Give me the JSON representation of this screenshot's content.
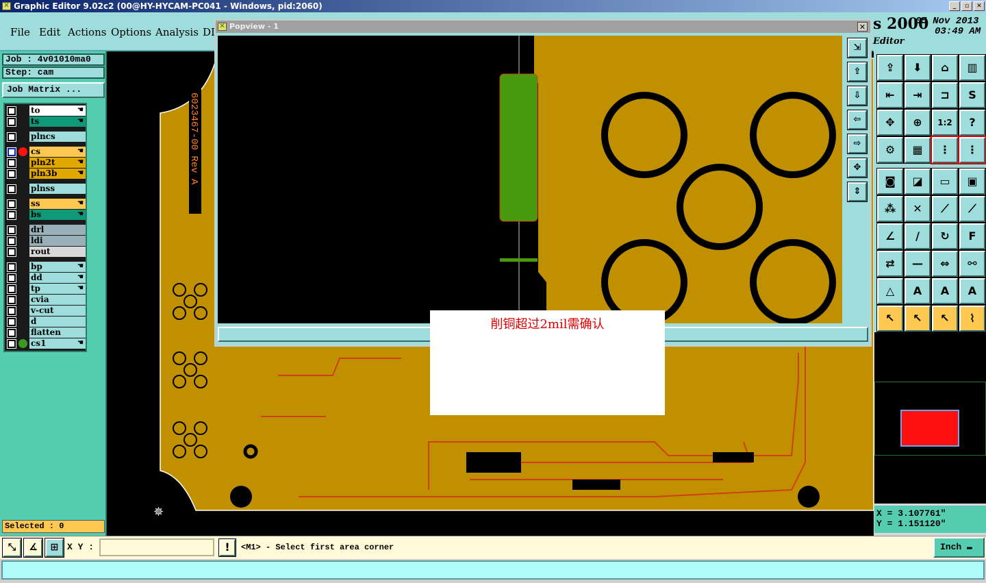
{
  "window": {
    "title": "Graphic Editor 9.02c2 (00@HY-HYCAM-PC041 - Windows, pid:2060)",
    "controls": [
      "_",
      "▫",
      "✕"
    ]
  },
  "menu": [
    "File",
    "Edit",
    "Actions",
    "Options",
    "Analysis",
    "DI"
  ],
  "header_right": {
    "product": "s 2000",
    "date": "05 Nov 2013",
    "time": "03:49 AM",
    "subtitle": "Editor"
  },
  "job": {
    "job_label": "Job : 4v01010ma0",
    "step_label": "Step: cam",
    "matrix_button": "Job Matrix ..."
  },
  "layers": [
    {
      "name": "to",
      "bg": "#ffffff",
      "hand": true
    },
    {
      "name": "ts",
      "bg": "#0e9a78",
      "hand": true
    },
    {
      "name": "plncs",
      "bg": "#9fdcdc",
      "hand": false
    },
    {
      "name": "cs",
      "bg": "#ffc850",
      "hand": true,
      "dot": "#ff1010",
      "active": true
    },
    {
      "name": "pln2t",
      "bg": "#e0a800",
      "hand": true
    },
    {
      "name": "pln3b",
      "bg": "#e0a800",
      "hand": true
    },
    {
      "name": "plnss",
      "bg": "#9fdcdc",
      "hand": false
    },
    {
      "name": "ss",
      "bg": "#ffc850",
      "hand": true
    },
    {
      "name": "bs",
      "bg": "#0e9a78",
      "hand": true
    },
    {
      "name": "drl",
      "bg": "#9ab0b8",
      "hand": false
    },
    {
      "name": "ldi",
      "bg": "#9ab0b8",
      "hand": false
    },
    {
      "name": "rout",
      "bg": "#d8d8d8",
      "hand": false
    },
    {
      "name": "bp",
      "bg": "#9fdcdc",
      "hand": true
    },
    {
      "name": "dd",
      "bg": "#9fdcdc",
      "hand": true
    },
    {
      "name": "tp",
      "bg": "#9fdcdc",
      "hand": true
    },
    {
      "name": "cvia",
      "bg": "#9fdcdc",
      "hand": false
    },
    {
      "name": "v-cut",
      "bg": "#9fdcdc",
      "hand": false
    },
    {
      "name": "d",
      "bg": "#9fdcdc",
      "hand": false
    },
    {
      "name": "flatten",
      "bg": "#9fdcdc",
      "hand": false
    },
    {
      "name": "cs1",
      "bg": "#9fdcdc",
      "hand": true,
      "dot": "#3a9a20"
    }
  ],
  "selected": "Selected : 0",
  "board": {
    "part_text": "6023467-00 Rev A",
    "copper_color": "#c09000",
    "trace_color": "#d04010"
  },
  "popview": {
    "title": "Popview - 1",
    "close": "✕"
  },
  "message": "削铜超过2mil需确认",
  "coords": {
    "x": "X  =  3.107761\"",
    "y": "Y  =  1.151120\""
  },
  "status": {
    "xy_label": "X Y :",
    "xy_value": "",
    "prompt": "<M1> - Select first area corner",
    "unit": "Inch",
    "alert": "!"
  },
  "toolbar_icons": [
    "import",
    "export",
    "home",
    "window",
    "zoom-in",
    "zoom-out",
    "mirror",
    "snap",
    "fit",
    "center",
    "ratio",
    "help",
    "measure",
    "grid",
    "layers-a",
    "layers-b",
    "feature",
    "draw",
    "ruler",
    "pad",
    "connect",
    "cross",
    "line-pad",
    "line-dot",
    "angle",
    "slope",
    "arc",
    "text-f",
    "move",
    "line",
    "resize",
    "select",
    "tri-a",
    "tri-b",
    "tri-c",
    "tri-d",
    "pointer",
    "pointer-box",
    "pointer-box2",
    "route"
  ],
  "toolbar_glyphs": [
    "⇪",
    "⬇",
    "⌂",
    "▥",
    "⇤",
    "⇥",
    "⊐",
    "S",
    "✥",
    "⊕",
    "1:2",
    "?",
    "⚙",
    "▦",
    "⋮",
    "⋮",
    "◙",
    "◪",
    "▭",
    "▣",
    "⁂",
    "✕",
    "⟋",
    "⟋",
    "∠",
    "/",
    "↻",
    "F",
    "⇄",
    "—",
    "⇔",
    "⚯",
    "△",
    "A",
    "A",
    "A",
    "↖",
    "↖",
    "↖",
    "⌇"
  ],
  "pop_tools": [
    "⇲",
    "⇪",
    "⇩",
    "⇦",
    "⇨",
    "✥",
    "⇕"
  ]
}
